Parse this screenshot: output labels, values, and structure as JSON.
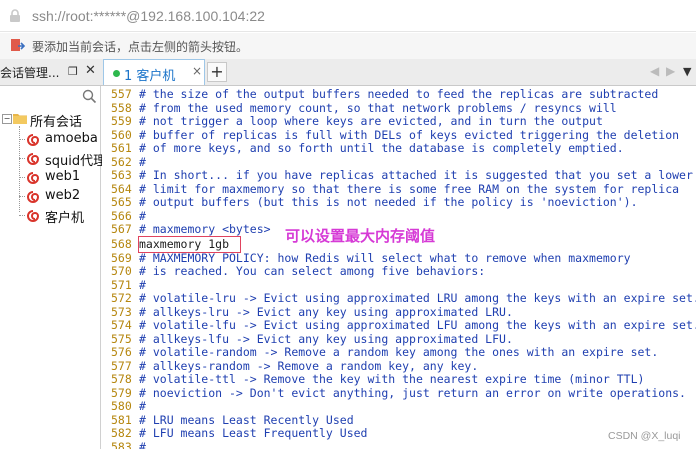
{
  "address_bar": {
    "url": "ssh://root:******@192.168.100.104:22"
  },
  "hint_bar": {
    "text": "要添加当前会话，点击左侧的箭头按钮。"
  },
  "tabs": {
    "session_manager_label": "会话管理...",
    "pin_symbol": "\u0002",
    "close_symbol": "✕",
    "active_tab_label": "1 客户机",
    "active_tab_close": "×",
    "add_tab_symbol": "+",
    "scroll_left": "◀",
    "scroll_right": "▶",
    "menu_symbol": "▼"
  },
  "sidebar": {
    "root_label": "所有会话",
    "root_toggle": "−",
    "items": [
      {
        "label": "amoeba"
      },
      {
        "label": "squid代理"
      },
      {
        "label": "web1"
      },
      {
        "label": "web2"
      },
      {
        "label": "客户机"
      }
    ]
  },
  "terminal": {
    "lines": [
      {
        "num": "557",
        "text": "# the size of the output buffers needed to feed the replicas are subtracted"
      },
      {
        "num": "558",
        "text": "# from the used memory count, so that network problems / resyncs will"
      },
      {
        "num": "559",
        "text": "# not trigger a loop where keys are evicted, and in turn the output"
      },
      {
        "num": "560",
        "text": "# buffer of replicas is full with DELs of keys evicted triggering the deletion"
      },
      {
        "num": "561",
        "text": "# of more keys, and so forth until the database is completely emptied."
      },
      {
        "num": "562",
        "text": "#"
      },
      {
        "num": "563",
        "text": "# In short... if you have replicas attached it is suggested that you set a lower"
      },
      {
        "num": "564",
        "text": "# limit for maxmemory so that there is some free RAM on the system for replica"
      },
      {
        "num": "565",
        "text": "# output buffers (but this is not needed if the policy is 'noeviction')."
      },
      {
        "num": "566",
        "text": "#"
      },
      {
        "num": "567",
        "text": "# maxmemory <bytes>"
      },
      {
        "num": "568",
        "text": "maxmemory 1gb"
      },
      {
        "num": "569",
        "text": "# MAXMEMORY POLICY: how Redis will select what to remove when maxmemory"
      },
      {
        "num": "570",
        "text": "# is reached. You can select among five behaviors:"
      },
      {
        "num": "571",
        "text": "#"
      },
      {
        "num": "572",
        "text": "# volatile-lru -> Evict using approximated LRU among the keys with an expire set."
      },
      {
        "num": "573",
        "text": "# allkeys-lru -> Evict any key using approximated LRU."
      },
      {
        "num": "574",
        "text": "# volatile-lfu -> Evict using approximated LFU among the keys with an expire set."
      },
      {
        "num": "575",
        "text": "# allkeys-lfu -> Evict any key using approximated LFU."
      },
      {
        "num": "576",
        "text": "# volatile-random -> Remove a random key among the ones with an expire set."
      },
      {
        "num": "577",
        "text": "# allkeys-random -> Remove a random key, any key."
      },
      {
        "num": "578",
        "text": "# volatile-ttl -> Remove the key with the nearest expire time (minor TTL)"
      },
      {
        "num": "579",
        "text": "# noeviction -> Don't evict anything, just return an error on write operations."
      },
      {
        "num": "580",
        "text": "#"
      },
      {
        "num": "581",
        "text": "# LRU means Least Recently Used"
      },
      {
        "num": "582",
        "text": "# LFU means Least Frequently Used"
      },
      {
        "num": "583",
        "text": "#"
      }
    ],
    "annotation": "可以设置最大内存阈值"
  },
  "watermark": "CSDN @X_luqi",
  "colors": {
    "comment": "#1f3fb0",
    "line_number": "#b5860e",
    "annotation": "#d63ad6",
    "highlight_border": "#e0435e",
    "tab_dot": "#2db84d"
  }
}
